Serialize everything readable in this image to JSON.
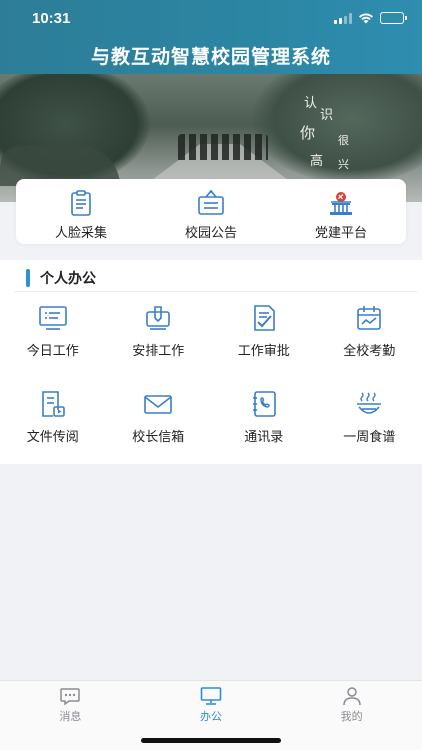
{
  "status_bar": {
    "time": "10:31"
  },
  "header": {
    "title": "与教互动智慧校园管理系统"
  },
  "banner": {
    "overlay_text": [
      "认",
      "识",
      "你",
      "很",
      "高",
      "兴"
    ]
  },
  "quick_actions": [
    {
      "label": "人脸采集",
      "icon": "face-capture-icon"
    },
    {
      "label": "校园公告",
      "icon": "bulletin-board-icon"
    },
    {
      "label": "党建平台",
      "icon": "party-building-icon"
    }
  ],
  "section": {
    "title": "个人办公",
    "items": [
      {
        "label": "今日工作",
        "icon": "monitor-list-icon"
      },
      {
        "label": "安排工作",
        "icon": "pen-note-icon"
      },
      {
        "label": "工作审批",
        "icon": "approve-document-icon"
      },
      {
        "label": "全校考勤",
        "icon": "calendar-chart-icon"
      },
      {
        "label": "文件传阅",
        "icon": "document-play-icon"
      },
      {
        "label": "校长信箱",
        "icon": "mail-icon"
      },
      {
        "label": "通讯录",
        "icon": "phone-book-icon"
      },
      {
        "label": "一周食谱",
        "icon": "bowl-icon"
      }
    ]
  },
  "tabbar": {
    "active": "办公",
    "tabs": [
      {
        "label": "消息",
        "icon": "message-icon"
      },
      {
        "label": "办公",
        "icon": "desktop-icon"
      },
      {
        "label": "我的",
        "icon": "user-icon"
      }
    ]
  },
  "colors": {
    "header": "#2b86a3",
    "accent": "#2d8fd9",
    "icon": "#3a7fc9",
    "background": "#f1f2f6"
  }
}
